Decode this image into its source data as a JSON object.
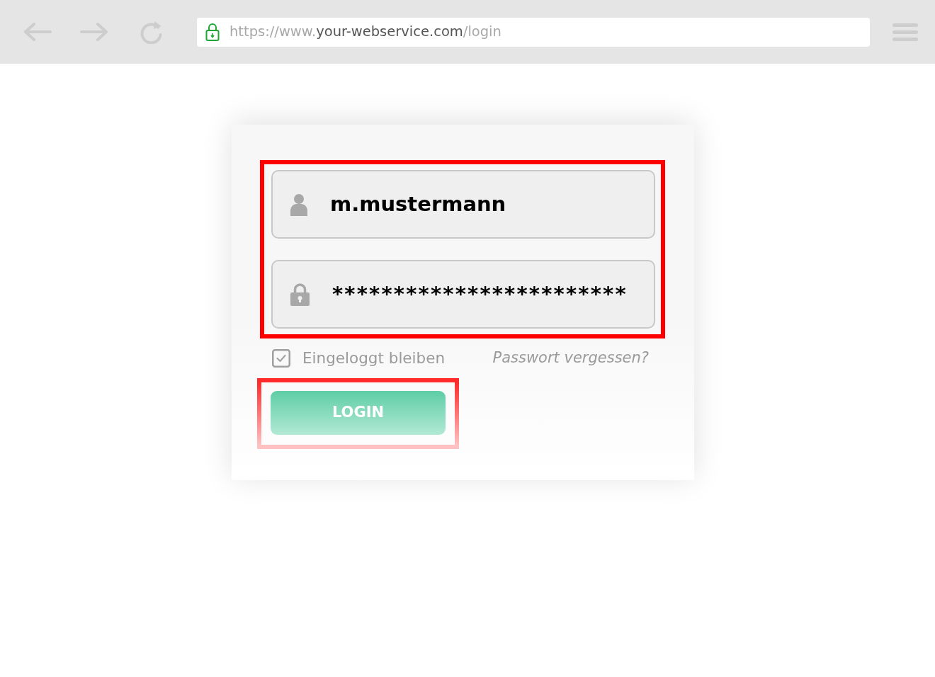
{
  "browser": {
    "address": {
      "secure": true,
      "prefix": "https://www.",
      "domain": "your-webservice.com",
      "path": "/login"
    }
  },
  "login_form": {
    "credentials": {
      "highlighted": true,
      "fields": [
        {
          "kind": "username",
          "value": "m.mustermann"
        },
        {
          "kind": "password",
          "value": "************************"
        }
      ]
    },
    "remember_me": {
      "label": "Eingeloggt bleiben",
      "checked": true
    },
    "forgot_password_link": "Passwort vergessen?",
    "login_button": {
      "label": "LOGIN",
      "highlighted": true
    }
  }
}
